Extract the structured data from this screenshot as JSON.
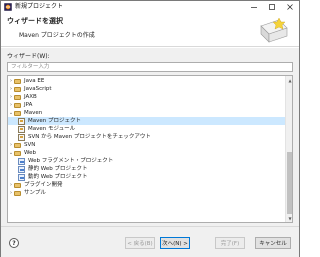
{
  "window": {
    "title": "新規プロジェクト"
  },
  "header": {
    "title": "ウィザードを選択",
    "description": "Maven プロジェクトの作成"
  },
  "wizards_label": "ウィザード(W):",
  "filter": {
    "placeholder": "フィルター入力",
    "value": ""
  },
  "tree": [
    {
      "label": "Java EE",
      "icon": "folder-icon",
      "expanded": false
    },
    {
      "label": "JavaScript",
      "icon": "folder-icon",
      "expanded": false
    },
    {
      "label": "JAXB",
      "icon": "folder-icon",
      "expanded": false
    },
    {
      "label": "JPA",
      "icon": "folder-icon",
      "expanded": false
    },
    {
      "label": "Maven",
      "icon": "folder-icon",
      "expanded": true
    },
    {
      "label": "Maven プロジェクト",
      "icon": "maven-project-icon",
      "selected": true
    },
    {
      "label": "Maven モジュール",
      "icon": "maven-module-icon"
    },
    {
      "label": "SVN から Maven プロジェクトをチェックアウト",
      "icon": "maven-svn-icon"
    },
    {
      "label": "SVN",
      "icon": "folder-icon",
      "expanded": false
    },
    {
      "label": "Web",
      "icon": "folder-icon",
      "expanded": true
    },
    {
      "label": "Web フラグメント・プロジェクト",
      "icon": "web-fragment-icon"
    },
    {
      "label": "静的 Web プロジェクト",
      "icon": "static-web-icon"
    },
    {
      "label": "動的 Web プロジェクト",
      "icon": "dynamic-web-icon"
    },
    {
      "label": "プラグイン開発",
      "icon": "folder-icon",
      "expanded": false
    },
    {
      "label": "サンプル",
      "icon": "folder-icon",
      "expanded": false
    }
  ],
  "buttons": {
    "help": "?",
    "back": "< 戻る(B)",
    "next": "次へ(N) >",
    "finish": "完了(F)",
    "cancel": "キャンセル"
  },
  "colors": {
    "selection": "#cce8ff",
    "default_button_border": "#0078d7",
    "folder": "#e8c26a"
  }
}
